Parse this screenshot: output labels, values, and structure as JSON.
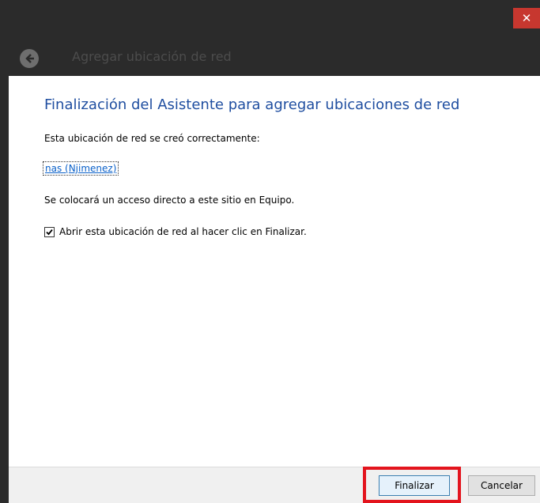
{
  "window": {
    "title": "Agregar ubicación de red",
    "close_glyph": "✕"
  },
  "content": {
    "heading": "Finalización del Asistente para agregar ubicaciones de red",
    "created_message": "Esta ubicación de red se creó correctamente:",
    "location_link": "nas (Njimenez)",
    "shortcut_message": "Se colocará un acceso directo a este sitio en Equipo.",
    "open_checkbox": {
      "label": "Abrir esta ubicación de red al hacer clic en Finalizar.",
      "checked": true
    }
  },
  "footer": {
    "finish_label": "Finalizar",
    "cancel_label": "Cancelar"
  },
  "colors": {
    "title_bar": "#2b2b2b",
    "close_button": "#c7372f",
    "heading": "#1f4ea0",
    "link": "#0b61c9",
    "highlight": "#e3141d"
  }
}
